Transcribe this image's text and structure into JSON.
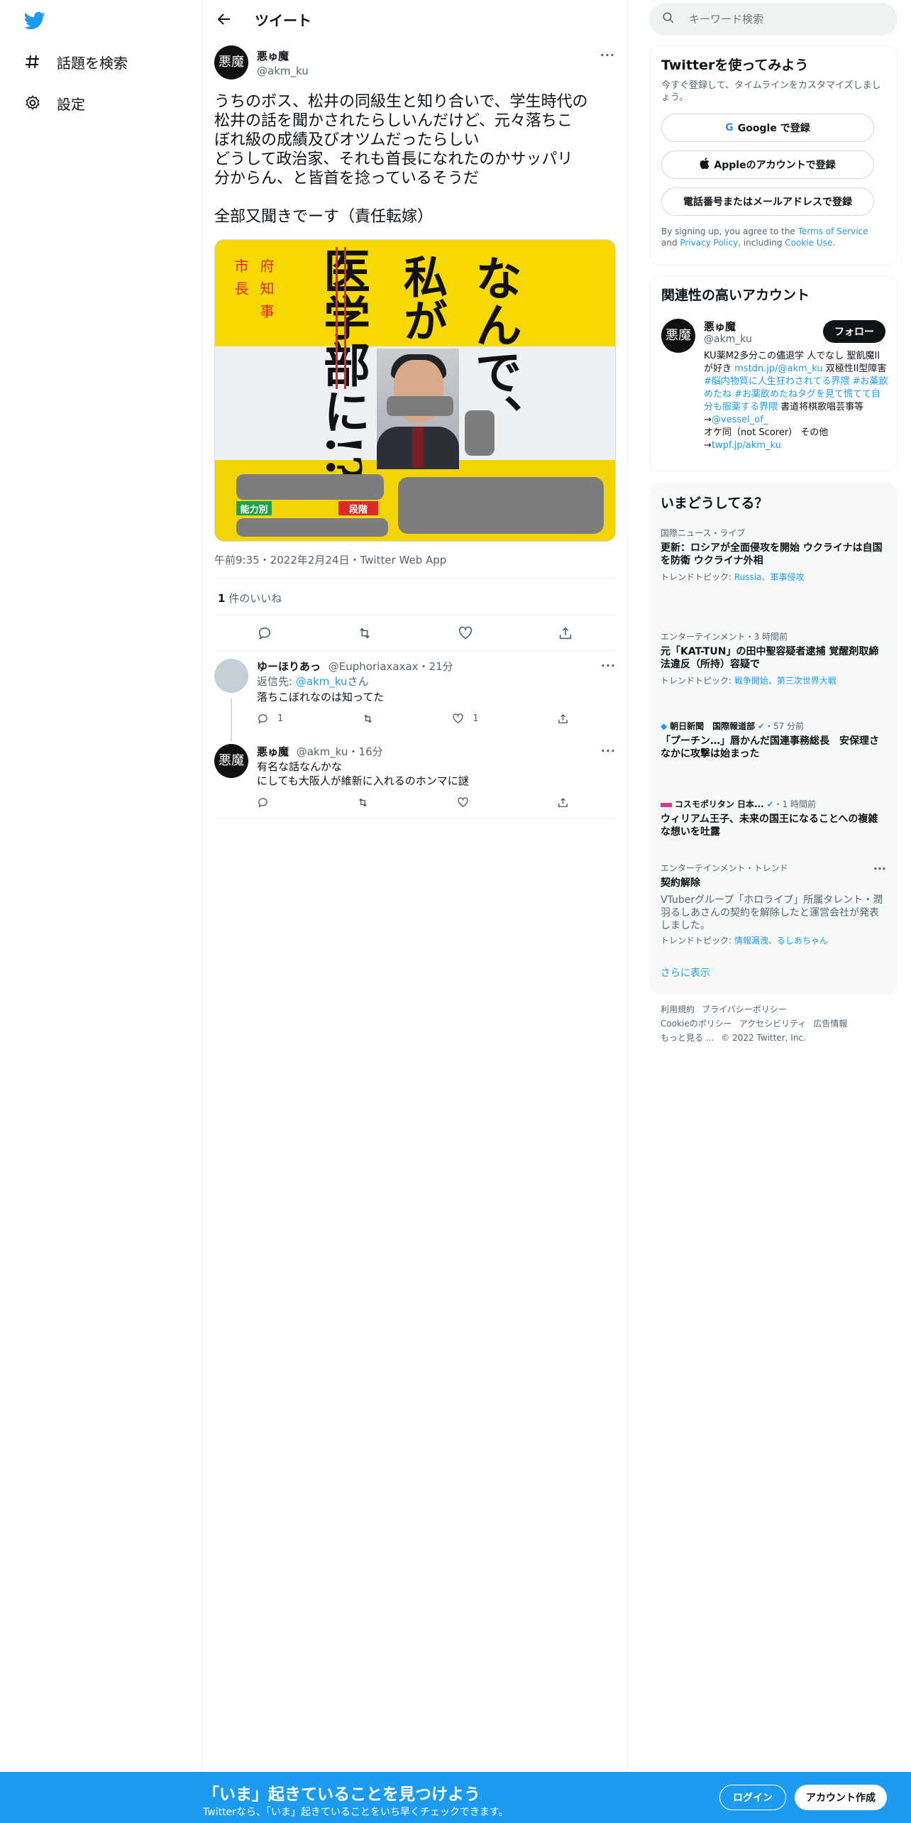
{
  "nav": {
    "explore_label": "話題を検索",
    "settings_label": "設定"
  },
  "header": {
    "title": "ツイート"
  },
  "tweet": {
    "author_name": "悪ゅ魔",
    "author_handle": "@akm_ku",
    "avatar_text": "悪魔",
    "text": "うちのボス、松井の同級生と知り合いで、学生時代の\n松井の話を聞かされたらしいんだけど、元々落ちこ\nぼれ級の成績及びオツムだったらしい\nどうして政治家、それも首長になれたのかサッパリ\n分からん、と皆首を捻っているそうだ\n\n全部又聞きでーす（責任転嫁）",
    "meta": "午前9:35・2022年2月24日・Twitter Web App",
    "likes_count": "1",
    "likes_label": " 件のいいね",
    "image": {
      "line1": "なんで、",
      "line2": "私が",
      "line3": "医学部に!?",
      "side_left": "市長",
      "side_right": "府知事",
      "tag_left": "能力別",
      "tag_right": "段階"
    }
  },
  "replies": [
    {
      "name": "ゆーほりあっ",
      "handle": "@Euphoriaxaxax",
      "time": "・21分",
      "reply_to_prefix": "返信先: ",
      "reply_to_handle": "@akm_ku",
      "reply_to_suffix": "さん",
      "text": "落ちこぼれなのは知ってた",
      "reply_count": "1",
      "like_count": "1"
    },
    {
      "name": "悪ゅ魔",
      "handle": "@akm_ku",
      "time": "・16分",
      "text": "有名な話なんかな\nにしても大阪人が維新に入れるのホンマに謎"
    }
  ],
  "search": {
    "placeholder": "キーワード検索"
  },
  "signup_card": {
    "title": "Twitterを使ってみよう",
    "desc": "今すぐ登録して、タイムラインをカスタマイズしましょう。",
    "google": "Google で登録",
    "apple": "Appleのアカウントで登録",
    "phone": "電話番号またはメールアドレスで登録",
    "terms_prefix": "By signing up, you agree to the ",
    "terms": "Terms of Service",
    "and": " and ",
    "privacy": "Privacy Policy",
    "including": ", including ",
    "cookie": "Cookie Use",
    "period": "."
  },
  "related": {
    "title": "関連性の高いアカウント",
    "name": "悪ゅ魔",
    "handle": "@akm_ku",
    "follow": "フォロー",
    "bio_1": "KU薬M2多分この儘退学 人でなし 聖飢魔IIが好き ",
    "bio_link1": "mstdn.jp/@akm_ku",
    "bio_2": " 双極性II型障害 ",
    "bio_tags": "#脳内物質に人生狂わされてる界隈 #お薬飲めたね #お薬飲めたねタグを見て慌てて自分も服薬する界隈",
    "bio_3": " 書道将棋歌唱芸事等→",
    "bio_link2": "@vessel_of_",
    "bio_4": "オケ同（not Scorer） その他→",
    "bio_link3": "twpf.jp/akm_ku"
  },
  "trends": {
    "title": "いまどうしてる？",
    "items": [
      {
        "context": "国際ニュース・ライブ",
        "title": "更新：ロシアが全面侵攻を開始 ウクライナは自国を防衛 ウクライナ外相",
        "sub_prefix": "トレンドトピック: ",
        "sub_links": "Russia、軍事侵攻"
      },
      {
        "context": "エンターテインメント・3 時間前",
        "title": "元「KAT-TUN」の田中聖容疑者逮捕 覚醒剤取締法違反（所持）容疑で",
        "sub_prefix": "トレンドトピック: ",
        "sub_links": "戦争開始、第三次世界大戦"
      },
      {
        "context": "朝日新聞　国際報道部",
        "context_time": "・57 分前",
        "title": "「プーチン…」唇かんだ国連事務総長　安保理さなかに攻撃は始まった"
      },
      {
        "context": "コスモポリタン 日本...",
        "context_time": "・1 時間前",
        "title": "ウィリアム王子、未来の国王になることへの複雑な想いを吐露"
      },
      {
        "context": "エンターテインメント・トレンド",
        "title": "契約解除",
        "desc": "VTuberグループ「ホロライブ」所属タレント・潤羽るしあさんの契約を解除したと運営会社が発表しました。",
        "sub_prefix": "トレンドトピック: ",
        "sub_links": "情報漏洩、るしあちゃん"
      }
    ],
    "show_more": "さらに表示"
  },
  "footer": {
    "terms": "利用規約",
    "privacy": "プライバシーポリシー",
    "cookie": "Cookieのポリシー",
    "accessibility": "アクセシビリティ",
    "ads": "広告情報",
    "more": "もっと見る ...",
    "copyright": "© 2022 Twitter, Inc."
  },
  "bottom_bar": {
    "title": "「いま」起きていることを見つけよう",
    "sub": "Twitterなら、「いま」起きていることをいち早くチェックできます。",
    "login": "ログイン",
    "signup": "アカウント作成"
  },
  "colors": {
    "accent": "#1d9bf0",
    "text": "#0f1419",
    "muted": "#536471"
  }
}
